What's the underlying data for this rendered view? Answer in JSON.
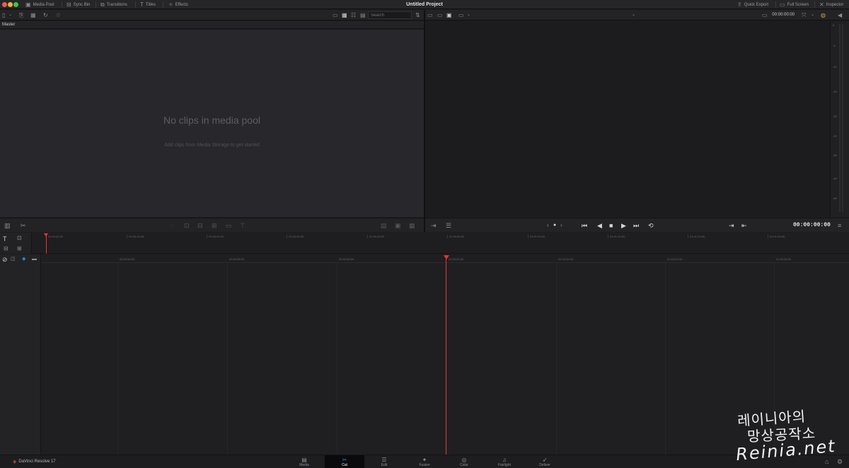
{
  "window": {
    "title": "Untitled Project"
  },
  "topbar": {
    "left_items": [
      {
        "label": "Media Pool",
        "icon": "media-pool-icon",
        "glyph": "▣",
        "active": true
      },
      {
        "label": "Sync Bin",
        "icon": "sync-bin-icon",
        "glyph": "⊟",
        "active": false
      },
      {
        "label": "Transitions",
        "icon": "transitions-icon",
        "glyph": "⧉",
        "active": false
      },
      {
        "label": "Titles",
        "icon": "titles-icon",
        "glyph": "T",
        "active": false
      },
      {
        "label": "Effects",
        "icon": "effects-icon",
        "glyph": "✧",
        "active": false
      }
    ],
    "right_items": [
      {
        "label": "Quick Export",
        "icon": "export-icon",
        "glyph": "⇪"
      },
      {
        "label": "Full Screen",
        "icon": "fullscreen-icon",
        "glyph": "▭"
      },
      {
        "label": "Inspector",
        "icon": "inspector-icon",
        "glyph": "✕"
      }
    ]
  },
  "toolbar": {
    "search_placeholder": "Search",
    "viewer_timecode": "00:00:00:00"
  },
  "media_pool": {
    "bin_name": "Master",
    "empty_title": "No clips in media pool",
    "empty_subtitle": "Add clips from Media Storage to get started"
  },
  "audio_meter": {
    "marks": [
      "0",
      "-5",
      "-10",
      "-15",
      "-20",
      "-25",
      "-30",
      "-40",
      "-50"
    ]
  },
  "viewer": {
    "timecode": "00:00:00:00"
  },
  "upper_timeline": {
    "ticks": [
      "01:00:00:00",
      "01:00:10:08",
      "01:00:20:16",
      "01:00:30:00",
      "01:00:40:00",
      "01:00:50:00",
      "01:01:00:00",
      "01:01:10:00",
      "01:01:20:00",
      "01:01:30:00"
    ]
  },
  "lower_timeline": {
    "ticks": [
      "00:59:54:00",
      "00:59:56:00",
      "00:59:58:00",
      "01:00:00:00",
      "01:00:02:00",
      "01:00:04:00",
      "01:00:06:00"
    ]
  },
  "bottom_nav": {
    "app_name": "DaVinci Resolve 17",
    "pages": [
      {
        "label": "Media",
        "icon": "media-page-icon",
        "glyph": "▤",
        "active": false
      },
      {
        "label": "Cut",
        "icon": "cut-page-icon",
        "glyph": "✂",
        "active": true
      },
      {
        "label": "Edit",
        "icon": "edit-page-icon",
        "glyph": "☰",
        "active": false
      },
      {
        "label": "Fusion",
        "icon": "fusion-page-icon",
        "glyph": "✦",
        "active": false
      },
      {
        "label": "Color",
        "icon": "color-page-icon",
        "glyph": "◎",
        "active": false
      },
      {
        "label": "Fairlight",
        "icon": "fairlight-page-icon",
        "glyph": "♫",
        "active": false
      },
      {
        "label": "Deliver",
        "icon": "deliver-page-icon",
        "glyph": "➶",
        "active": false
      }
    ]
  },
  "watermark": {
    "line1": "레이니아의",
    "line2": "망상공작소",
    "line3": "Reinia.net"
  }
}
